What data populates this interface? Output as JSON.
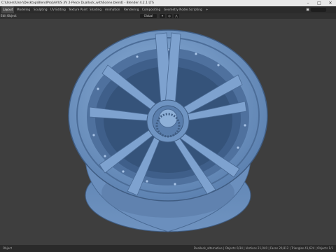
{
  "window": {
    "title": "C:\\Users\\User\\Desktop\\BlendProj\\AVUS 3V 2-Piece Duallock_withScene.blend] - Blender 4.2.1 LTS",
    "controls": [
      "–",
      "□",
      "✕"
    ]
  },
  "workspace_tabs": [
    {
      "label": "Layout",
      "active": true
    },
    {
      "label": "Modeling",
      "active": false
    },
    {
      "label": "Sculpting",
      "active": false
    },
    {
      "label": "UV Editing",
      "active": false
    },
    {
      "label": "Texture Paint",
      "active": false
    },
    {
      "label": "Shading",
      "active": false
    },
    {
      "label": "Animation",
      "active": false
    },
    {
      "label": "Rendering",
      "active": false
    },
    {
      "label": "Compositing",
      "active": false
    },
    {
      "label": "Geometry Nodes",
      "active": false
    },
    {
      "label": "Scripting",
      "active": false
    },
    {
      "label": "+",
      "active": false
    }
  ],
  "header": {
    "edit_label": "Edit",
    "object_label": "Object",
    "orientation": "Global",
    "scene_icon": "scene-icon"
  },
  "status": {
    "left": "Object",
    "right": "Duallock_alternative | Objects 0/34 | Vertices 21,040 | Faces 20,812 | Triangles 41,624 | Objects 1/1"
  },
  "colors": {
    "viewport_bg": "#3e3e3e",
    "wheel": "#6a8fbd",
    "wheel_dark": "#4e6f9a",
    "wheel_light": "#8aaed8"
  }
}
